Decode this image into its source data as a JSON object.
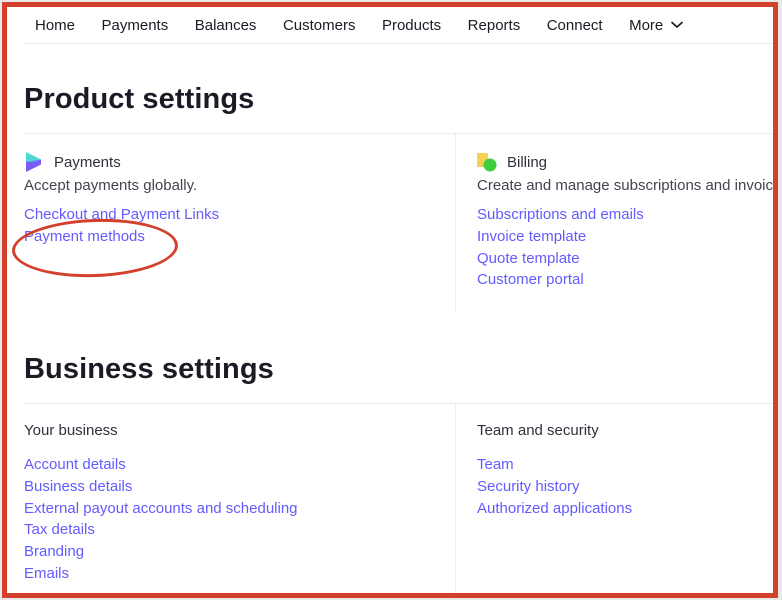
{
  "nav": {
    "items": [
      "Home",
      "Payments",
      "Balances",
      "Customers",
      "Products",
      "Reports",
      "Connect"
    ],
    "more_label": "More"
  },
  "product_settings": {
    "title": "Product settings",
    "payments": {
      "icon": "payments-logo-icon",
      "title": "Payments",
      "description": "Accept payments globally.",
      "links": [
        "Checkout and Payment Links",
        "Payment methods"
      ]
    },
    "billing": {
      "icon": "billing-logo-icon",
      "title": "Billing",
      "description": "Create and manage subscriptions and invoices",
      "links": [
        "Subscriptions and emails",
        "Invoice template",
        "Quote template",
        "Customer portal"
      ]
    }
  },
  "business_settings": {
    "title": "Business settings",
    "your_business": {
      "title": "Your business",
      "links": [
        "Account details",
        "Business details",
        "External payout accounts and scheduling",
        "Tax details",
        "Branding",
        "Emails"
      ]
    },
    "team_security": {
      "title": "Team and security",
      "links": [
        "Team",
        "Security history",
        "Authorized applications"
      ]
    }
  },
  "annotation": {
    "target": "Payment methods",
    "color": "#d3402c"
  },
  "colors": {
    "link": "#635bff",
    "frame": "#d3402c"
  }
}
